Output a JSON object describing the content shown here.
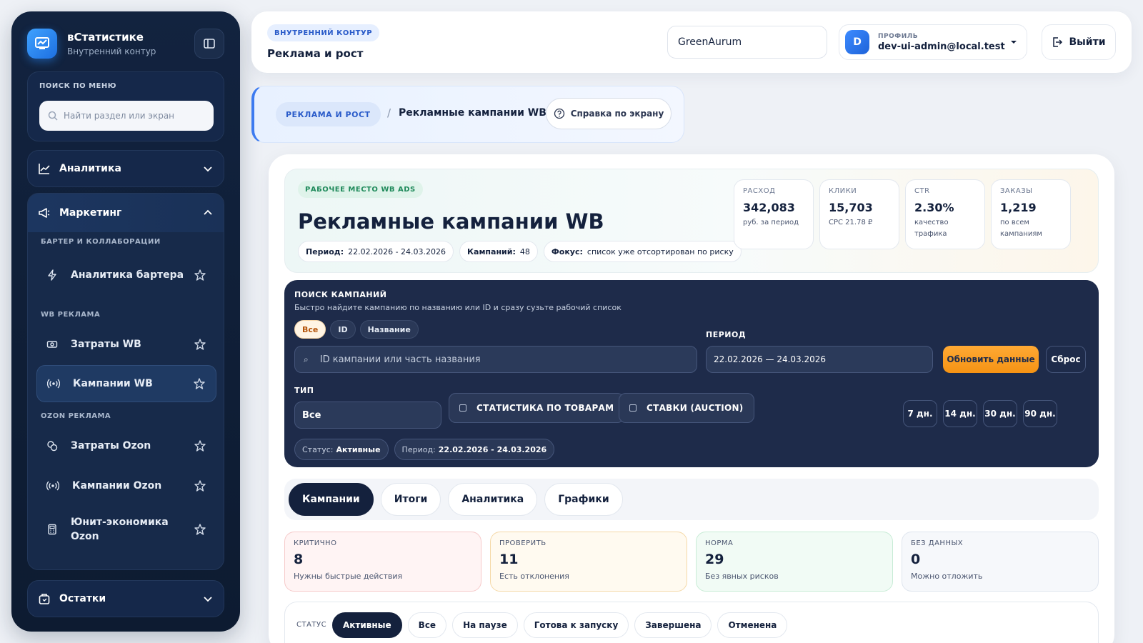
{
  "sidebar": {
    "brand_title": "вСтатистике",
    "brand_sub": "Внутренний контур",
    "search_label": "ПОИСК ПО МЕНЮ",
    "search_placeholder": "Найти раздел или экран",
    "groups": {
      "analytics": "Аналитика",
      "marketing": "Маркетинг",
      "stock": "Остатки"
    },
    "sections": {
      "barter": "БАРТЕР И КОЛЛАБОРАЦИИ",
      "wb_ads": "WB РЕКЛАМА",
      "ozon_ads": "OZON РЕКЛАМА"
    },
    "items": [
      {
        "label": "Аналитика бартера",
        "icon": "bolt-icon"
      },
      {
        "label": "Затраты WB",
        "icon": "cash-icon"
      },
      {
        "label": "Кампании WB",
        "icon": "broadcast-icon"
      },
      {
        "label": "Затраты Ozon",
        "icon": "coins-icon"
      },
      {
        "label": "Кампании Ozon",
        "icon": "broadcast-icon"
      },
      {
        "label": "Юнит-экономика Ozon",
        "icon": "calculator-icon"
      }
    ]
  },
  "header": {
    "pill": "ВНУТРЕННИЙ КОНТУР",
    "title": "Реклама и рост",
    "store_value": "GreenAurum",
    "profile_cap": "ПРОФИЛЬ",
    "avatar_letter": "D",
    "profile_email": "dev-ui-admin@local.test",
    "logout_label": "Выйти"
  },
  "breadcrumb": {
    "parent": "РЕКЛАМА И РОСТ",
    "separator": "/",
    "current": "Рекламные кампании WB",
    "help_label": "Справка по экрану"
  },
  "hero": {
    "pill": "РАБОЧЕЕ МЕСТО WB ADS",
    "title": "Рекламные кампании WB",
    "chips": [
      {
        "label": "Период:",
        "value": "22.02.2026 - 24.03.2026"
      },
      {
        "label": "Кампаний:",
        "value": "48"
      },
      {
        "label": "Фокус:",
        "value": "список уже отсортирован по риску"
      }
    ],
    "kpis": [
      {
        "cap": "РАСХОД",
        "value": "342,083",
        "sub": "руб. за период"
      },
      {
        "cap": "КЛИКИ",
        "value": "15,703",
        "sub": "CPC 21.78 ₽"
      },
      {
        "cap": "CTR",
        "value": "2.30%",
        "sub": "качество трафика"
      },
      {
        "cap": "ЗАКАЗЫ",
        "value": "1,219",
        "sub": "по всем кампаниям"
      }
    ]
  },
  "search": {
    "title": "ПОИСК КАМПАНИЙ",
    "subtitle": "Быстро найдите кампанию по названию или ID и сразу сузьте рабочий список",
    "modes": [
      "Все",
      "ID",
      "Название"
    ],
    "input_placeholder": "ID кампании или часть названия",
    "period_label": "ПЕРИОД",
    "period_value": "22.02.2026 — 24.03.2026",
    "refresh_label": "Обновить данные",
    "reset_label": "Сброс",
    "type_label": "ТИП",
    "type_value": "Все",
    "check_stats": "СТАТИСТИКА ПО ТОВАРАМ",
    "check_bids": "СТАВКИ (AUCTION)",
    "days": [
      "7 дн.",
      "14 дн.",
      "30 дн.",
      "90 дн."
    ],
    "filters": [
      {
        "label": "Статус:",
        "value": "Активные"
      },
      {
        "label": "Период:",
        "value": "22.02.2026 - 24.03.2026"
      }
    ]
  },
  "tabs": [
    "Кампании",
    "Итоги",
    "Аналитика",
    "Графики"
  ],
  "risk": [
    {
      "cap": "КРИТИЧНО",
      "value": "8",
      "sub": "Нужны быстрые действия"
    },
    {
      "cap": "ПРОВЕРИТЬ",
      "value": "11",
      "sub": "Есть отклонения"
    },
    {
      "cap": "НОРМА",
      "value": "29",
      "sub": "Без явных рисков"
    },
    {
      "cap": "БЕЗ ДАННЫХ",
      "value": "0",
      "sub": "Можно отложить"
    }
  ],
  "status": {
    "label": "СТАТУС",
    "options": [
      "Активные",
      "Все",
      "На паузе",
      "Готова к запуску",
      "Завершена",
      "Отменена"
    ]
  },
  "colors": {
    "sidebar_bg": "#12233f",
    "accent_orange": "#f59314",
    "dark_panel": "#1e2b4a",
    "critical": "#fff4f4",
    "check": "#fffaf0",
    "norm": "#f1fbf5",
    "nodata": "#f6f8fb"
  }
}
